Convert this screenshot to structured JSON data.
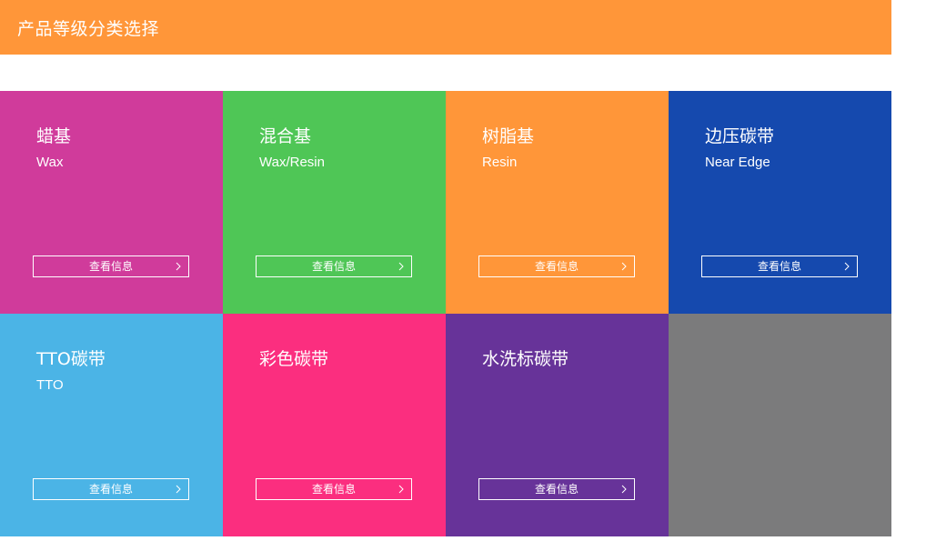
{
  "header": {
    "title": "产品等级分类选择",
    "color": "#ff9639"
  },
  "tiles": [
    {
      "title": "蜡基",
      "subtitle": "Wax",
      "button_label": "查看信息",
      "color": "#d03b9b"
    },
    {
      "title": "混合基",
      "subtitle": "Wax/Resin",
      "button_label": "查看信息",
      "color": "#4fc656"
    },
    {
      "title": "树脂基",
      "subtitle": "Resin",
      "button_label": "查看信息",
      "color": "#ff9639"
    },
    {
      "title": "边压碳带",
      "subtitle": "Near Edge",
      "button_label": "查看信息",
      "color": "#1549ae"
    },
    {
      "title": "TTO碳带",
      "subtitle": "TTO",
      "button_label": "查看信息",
      "color": "#4bb4e6"
    },
    {
      "title": "彩色碳带",
      "subtitle": "",
      "button_label": "查看信息",
      "color": "#fb2e7f"
    },
    {
      "title": "水洗标碳带",
      "subtitle": "",
      "button_label": "查看信息",
      "color": "#673399"
    },
    {
      "title": "",
      "subtitle": "",
      "button_label": "",
      "color": "#7b7b7c"
    }
  ],
  "icons": {
    "button_arrow": "chevron-right-icon"
  }
}
